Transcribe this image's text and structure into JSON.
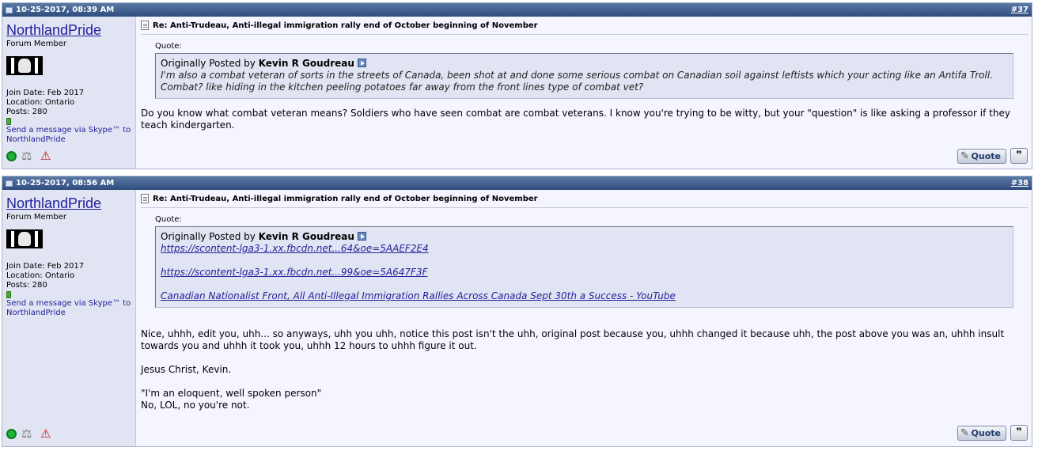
{
  "posts": [
    {
      "date": "10-25-2017, 08:39 AM",
      "number": "#37",
      "username": "NorthlandPride",
      "user_title": "Forum Member",
      "join_date": "Join Date: Feb 2017",
      "location": "Location: Ontario",
      "posts": "Posts: 280",
      "skype": "Send a message via Skype™ to NorthlandPride",
      "title": "Re: Anti-Trudeau, Anti-illegal immigration rally end of October beginning of November",
      "quote_label": "Quote:",
      "quote_prefix": "Originally Posted by",
      "quote_author": "Kevin R Goudreau",
      "quote_text": "I'm also a combat veteran of sorts in the streets of Canada, been shot at and done some serious combat on Canadian soil against leftists which your acting like an Antifa Troll. Combat? like hiding in the kitchen peeling potatoes far away from the front lines type of combat vet?",
      "message": [
        "Do you know what combat veteran means? Soldiers who have seen combat are combat veterans. I know you're trying to be witty, but your \"question\" is like asking a professor if they teach kindergarten."
      ],
      "quote_button": "Quote"
    },
    {
      "date": "10-25-2017, 08:56 AM",
      "number": "#38",
      "username": "NorthlandPride",
      "user_title": "Forum Member",
      "join_date": "Join Date: Feb 2017",
      "location": "Location: Ontario",
      "posts": "Posts: 280",
      "skype": "Send a message via Skype™ to NorthlandPride",
      "title": "Re: Anti-Trudeau, Anti-illegal immigration rally end of October beginning of November",
      "quote_label": "Quote:",
      "quote_prefix": "Originally Posted by",
      "quote_author": "Kevin R Goudreau",
      "quote_links": [
        "https://scontent-lga3-1.xx.fbcdn.net...64&oe=5AAEF2E4",
        "https://scontent-lga3-1.xx.fbcdn.net...99&oe=5A647F3F",
        "Canadian Nationalist Front, All Anti-Illegal Immigration Rallies Across Canada Sept 30th a Success - YouTube"
      ],
      "message": [
        "Nice, uhhh, edit you, uhh... so anyways, uhh you uhh, notice this post isn't the uhh, original post because you, uhhh changed it because uhh, the post above you was an, uhhh insult towards you and uhhh it took you, uhhh 12 hours to uhhh figure it out.",
        "Jesus Christ, Kevin.",
        "\"I'm an eloquent, well spoken person\"",
        "No, LOL, no you're not."
      ],
      "quote_button": "Quote"
    }
  ],
  "icons": {
    "online": "online-status-icon",
    "reputation": "reputation-icon",
    "report": "report-post-icon",
    "post": "post-document-icon",
    "view_post": "view-post-icon",
    "multiquote": "multiquote-icon"
  }
}
